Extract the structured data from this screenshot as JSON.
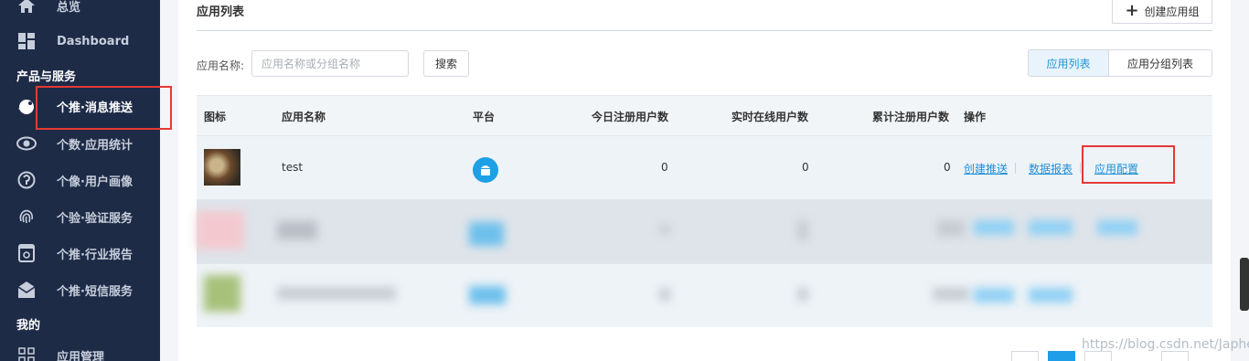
{
  "sidebar": {
    "items": [
      {
        "label": "总览",
        "icon": "home-icon"
      },
      {
        "label": "Dashboard",
        "icon": "dashboard-icon"
      },
      {
        "label": "个推·消息推送",
        "icon": "bird-icon"
      },
      {
        "label": "个数·应用统计",
        "icon": "eye-icon"
      },
      {
        "label": "个像·用户画像",
        "icon": "profile-icon"
      },
      {
        "label": "个验·验证服务",
        "icon": "fingerprint-icon"
      },
      {
        "label": "个推·行业报告",
        "icon": "report-icon"
      },
      {
        "label": "个推·短信服务",
        "icon": "sms-icon"
      },
      {
        "label": "应用管理",
        "icon": "apps-icon"
      }
    ],
    "section_products": "产品与服务",
    "section_mine": "我的"
  },
  "main": {
    "title": "应用列表",
    "create_group_label": "创建应用组",
    "filter_label": "应用名称:",
    "search_placeholder": "应用名称或分组名称",
    "search_button": "搜索",
    "tabs": [
      "应用列表",
      "应用分组列表"
    ]
  },
  "table": {
    "headers": [
      "图标",
      "应用名称",
      "平台",
      "今日注册用户数",
      "实时在线用户数",
      "累计注册用户数",
      "操作"
    ],
    "rows": [
      {
        "name": "test",
        "today": "0",
        "online": "0",
        "total": "0",
        "actions": [
          "创建推送",
          "数据报表",
          "应用配置"
        ]
      }
    ]
  },
  "watermark": "https://blog.csdn.net/Japhet_jiu",
  "colors": {
    "sidebar_bg": "#1e2b47",
    "accent": "#1f9cf0",
    "link": "#1f8fd6",
    "highlight": "#e53935"
  }
}
